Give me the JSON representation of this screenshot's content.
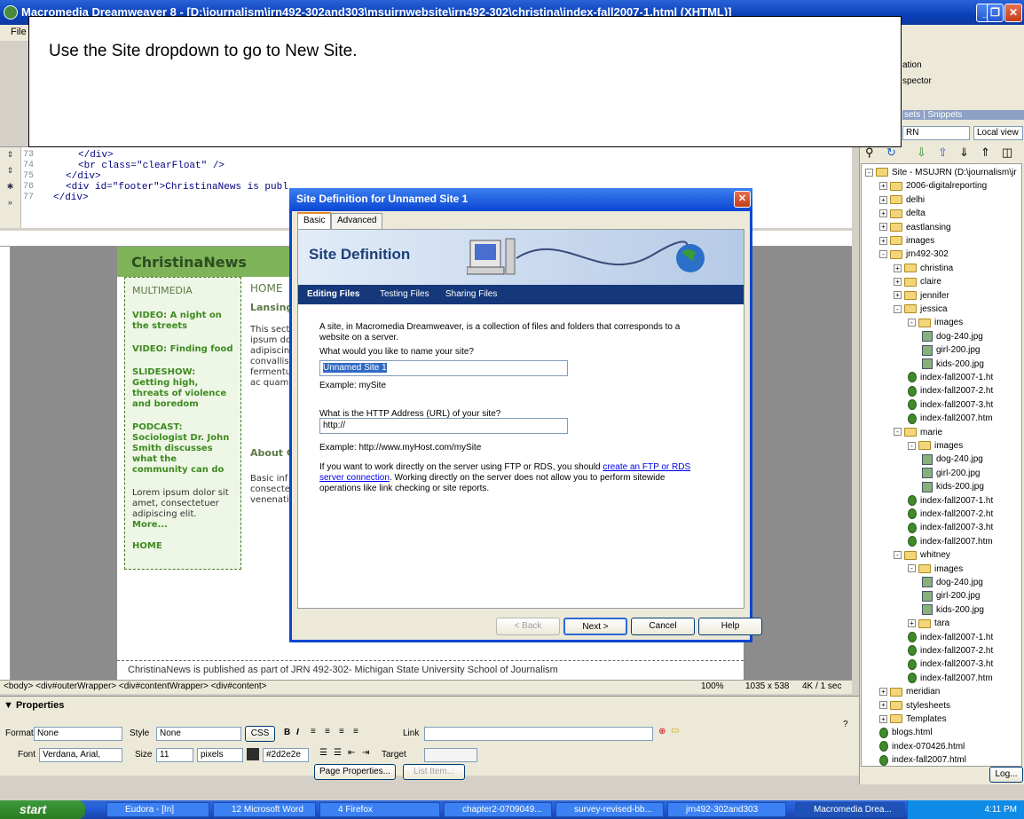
{
  "window": {
    "title": "Macromedia Dreamweaver 8 - [D:\\journalism\\jrn492-302and303\\msujrnwebsite\\jrn492-302\\christina\\index-fall2007-1.html (XHTML)]",
    "menu_first": "File"
  },
  "callout": {
    "text": "Use the Site dropdown to go to New Site."
  },
  "code": {
    "line_numbers": [
      "73",
      "74",
      "75",
      "76",
      "77"
    ],
    "lines": [
      "</div>",
      "<br class=\"clearFloat\" />",
      "</div>",
      "<div id=\"footer\">ChristinaNews is publ",
      "</div>"
    ]
  },
  "design": {
    "site_title": "ChristinaNews",
    "sidebar": {
      "heading": "MULTIMEDIA",
      "links": [
        "VIDEO: A night on the streets",
        "VIDEO: Finding food",
        "SLIDESHOW: Getting high, threats of violence and boredom",
        "PODCAST: Sociologist Dr. John Smith discusses what the community can do"
      ],
      "body": "Lorem ipsum dolor sit amet, consectetuer adipiscing elit.",
      "more": "More...",
      "home": "HOME"
    },
    "main_heading": "HOME",
    "main_sub": "Lansing",
    "main_blurb": "This sect ipsum do adipiscin convallis fermentu ac quam",
    "about": "About C",
    "about_body": "Basic inf consecte venenati",
    "footer": "ChristinaNews is published as part of JRN 492-302- Michigan State University School of Journalism"
  },
  "statusbar": {
    "tags": "<body> <div#outerWrapper> <div#contentWrapper> <div#content>",
    "zoom": "100%",
    "size": "1035 x 538",
    "weight": "4K / 1 sec"
  },
  "properties": {
    "title": "▼ Properties",
    "format_label": "Format",
    "format_value": "None",
    "style_label": "Style",
    "style_value": "None",
    "css_label": "CSS",
    "link_label": "Link",
    "font_label": "Font",
    "font_value": "Verdana, Arial,",
    "size_label": "Size",
    "size_value": "11",
    "unit_value": "pixels",
    "color_value": "#2d2e2e",
    "target_label": "Target",
    "page_props": "Page Properties...",
    "list_item": "List Item..."
  },
  "panel": {
    "tab1": "ation",
    "tab2": "spector",
    "tab3": "sets | Snippets",
    "site_select": "RN",
    "view_select": "Local view",
    "log_button": "Log..."
  },
  "tree": [
    {
      "label": "Site - MSUJRN (D:\\journalism\\jr",
      "type": "folder",
      "level": 0,
      "pm": "-"
    },
    {
      "label": "2006-digitalreporting",
      "type": "folder",
      "level": 1,
      "pm": "+"
    },
    {
      "label": "delhi",
      "type": "folder",
      "level": 1,
      "pm": "+"
    },
    {
      "label": "delta",
      "type": "folder",
      "level": 1,
      "pm": "+"
    },
    {
      "label": "eastlansing",
      "type": "folder",
      "level": 1,
      "pm": "+"
    },
    {
      "label": "images",
      "type": "folder",
      "level": 1,
      "pm": "+"
    },
    {
      "label": "jrn492-302",
      "type": "folder",
      "level": 1,
      "pm": "-"
    },
    {
      "label": "christina",
      "type": "folder",
      "level": 2,
      "pm": "+"
    },
    {
      "label": "claire",
      "type": "folder",
      "level": 2,
      "pm": "+"
    },
    {
      "label": "jennifer",
      "type": "folder",
      "level": 2,
      "pm": "+"
    },
    {
      "label": "jessica",
      "type": "folder",
      "level": 2,
      "pm": "-"
    },
    {
      "label": "images",
      "type": "folder",
      "level": 3,
      "pm": "-"
    },
    {
      "label": "dog-240.jpg",
      "type": "img",
      "level": 4,
      "pm": ""
    },
    {
      "label": "girl-200.jpg",
      "type": "img",
      "level": 4,
      "pm": ""
    },
    {
      "label": "kids-200.jpg",
      "type": "img",
      "level": 4,
      "pm": ""
    },
    {
      "label": "index-fall2007-1.ht",
      "type": "file",
      "level": 3,
      "pm": ""
    },
    {
      "label": "index-fall2007-2.ht",
      "type": "file",
      "level": 3,
      "pm": ""
    },
    {
      "label": "index-fall2007-3.ht",
      "type": "file",
      "level": 3,
      "pm": ""
    },
    {
      "label": "index-fall2007.htm",
      "type": "file",
      "level": 3,
      "pm": ""
    },
    {
      "label": "marie",
      "type": "folder",
      "level": 2,
      "pm": "-"
    },
    {
      "label": "images",
      "type": "folder",
      "level": 3,
      "pm": "-"
    },
    {
      "label": "dog-240.jpg",
      "type": "img",
      "level": 4,
      "pm": ""
    },
    {
      "label": "girl-200.jpg",
      "type": "img",
      "level": 4,
      "pm": ""
    },
    {
      "label": "kids-200.jpg",
      "type": "img",
      "level": 4,
      "pm": ""
    },
    {
      "label": "index-fall2007-1.ht",
      "type": "file",
      "level": 3,
      "pm": ""
    },
    {
      "label": "index-fall2007-2.ht",
      "type": "file",
      "level": 3,
      "pm": ""
    },
    {
      "label": "index-fall2007-3.ht",
      "type": "file",
      "level": 3,
      "pm": ""
    },
    {
      "label": "index-fall2007.htm",
      "type": "file",
      "level": 3,
      "pm": ""
    },
    {
      "label": "whitney",
      "type": "folder",
      "level": 2,
      "pm": "-"
    },
    {
      "label": "images",
      "type": "folder",
      "level": 3,
      "pm": "-"
    },
    {
      "label": "dog-240.jpg",
      "type": "img",
      "level": 4,
      "pm": ""
    },
    {
      "label": "girl-200.jpg",
      "type": "img",
      "level": 4,
      "pm": ""
    },
    {
      "label": "kids-200.jpg",
      "type": "img",
      "level": 4,
      "pm": ""
    },
    {
      "label": "tara",
      "type": "folder",
      "level": 3,
      "pm": "+"
    },
    {
      "label": "index-fall2007-1.ht",
      "type": "file",
      "level": 3,
      "pm": ""
    },
    {
      "label": "index-fall2007-2.ht",
      "type": "file",
      "level": 3,
      "pm": ""
    },
    {
      "label": "index-fall2007-3.ht",
      "type": "file",
      "level": 3,
      "pm": ""
    },
    {
      "label": "index-fall2007.htm",
      "type": "file",
      "level": 3,
      "pm": ""
    },
    {
      "label": "meridian",
      "type": "folder",
      "level": 1,
      "pm": "+"
    },
    {
      "label": "stylesheets",
      "type": "folder",
      "level": 1,
      "pm": "+"
    },
    {
      "label": "Templates",
      "type": "folder",
      "level": 1,
      "pm": "+"
    },
    {
      "label": "blogs.html",
      "type": "file",
      "level": 1,
      "pm": ""
    },
    {
      "label": "index-070426.html",
      "type": "file",
      "level": 1,
      "pm": ""
    },
    {
      "label": "index-fall2007.html",
      "type": "file",
      "level": 1,
      "pm": ""
    }
  ],
  "dialog": {
    "title": "Site Definition for Unnamed Site 1",
    "tab_basic": "Basic",
    "tab_advanced": "Advanced",
    "banner_title": "Site Definition",
    "sub_editing": "Editing Files",
    "sub_testing": "Testing Files",
    "sub_sharing": "Sharing Files",
    "intro": "A site, in Macromedia Dreamweaver, is a collection of files and folders that corresponds to a website on a server.",
    "q_name": "What would you like to name your site?",
    "name_value": "Unnamed Site 1",
    "name_example": "Example: mySite",
    "q_url": "What is the HTTP Address (URL) of your site?",
    "url_value": "http://",
    "url_example": "Example: http://www.myHost.com/mySite",
    "ftp_pre": "If you want to work directly on the server using FTP or RDS, you should",
    "ftp_link": "create an FTP or RDS server connection",
    "ftp_post": ". Working directly on the server does not allow you to perform sitewide operations like link checking or site reports.",
    "btn_back": "< Back",
    "btn_next": "Next >",
    "btn_cancel": "Cancel",
    "btn_help": "Help"
  },
  "taskbar": {
    "start": "start",
    "tasks": [
      "Eudora - [In]",
      "12 Microsoft Word",
      "4 Firefox",
      "chapter2-0709049...",
      "survey-revised-bb...",
      "jrn492-302and303",
      "Macromedia Drea..."
    ],
    "clock": "4:11 PM"
  }
}
